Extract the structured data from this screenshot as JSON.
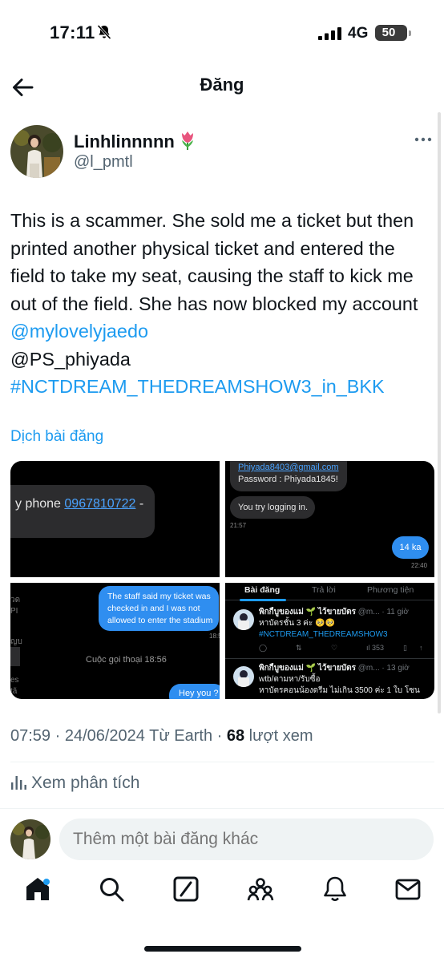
{
  "status_bar": {
    "time": "17:11",
    "network": "4G",
    "battery": "50"
  },
  "header": {
    "title": "Đăng"
  },
  "author": {
    "display_name": "Linhlinnnnn",
    "handle": "@l_pmtl"
  },
  "post": {
    "text": "This is a scammer. She sold me a ticket but then printed another physical ticket and entered the field to take my seat, causing the staff to kick me out of the field. She has now blocked my account ",
    "mention_1": "@mylovelyjaedo",
    "mention_2": "@PS_phiyada",
    "hashtag": "#NCTDREAM_THEDREAMSHOW3_in_BKK",
    "translate_label": "Dịch bài đăng"
  },
  "media": {
    "m1": {
      "prefix": "y phone ",
      "number": "0967810722",
      "suffix": " -"
    },
    "m2": {
      "email": "Phiyada8403@gmail.com",
      "password": "Password : Phiyada1845!",
      "msg": "You try logging in.",
      "time1": "21:57",
      "reply": "14 ka",
      "time2": "22:40"
    },
    "m3": {
      "side_1": "วด",
      "side_2": "PI",
      "side_3": "ญบ",
      "side_4": "es",
      "side_5": "tã",
      "blue_msg": "The staff said my ticket was checked in and I was not allowed to enter the stadium",
      "time": "18:5",
      "call": "Cuộc gọi thoại 18:56",
      "reply": "Hey you ?"
    },
    "m4": {
      "tab_1": "Bài đăng",
      "tab_2": "Trả lời",
      "tab_3": "Phương tiện",
      "p1_name": "พิกกี้บูของแม่ 🌱 ไว้ขายบัตร",
      "p1_meta": "@m... · 11 giờ",
      "p1_line": "หาบัตรชั้น 3 ค่ะ 🥺🥺",
      "p1_tag": "#NCTDREAM_THEDREAMSHOW3",
      "p1_views": "353",
      "p2_name": "พิกกี้บูของแม่ 🌱 ไว้ขายบัตร",
      "p2_meta": "@m... · 13 giờ",
      "p2_line1": "wtb/ตามหา/รับซื้อ",
      "p2_line2": "หาบัตรคอนน้องดรีม ไม่เกิน 3500 ค่ะ 1 ใบ โซน"
    }
  },
  "meta": {
    "time": "07:59 · 24/06/2024 Từ Earth · ",
    "views_count": "68",
    "views_label": " lượt xem"
  },
  "analytics": {
    "label": "Xem phân tích"
  },
  "reply": {
    "placeholder": "Thêm một bài đăng khác"
  },
  "colors": {
    "accent": "#1d9bf0",
    "text": "#0f1419",
    "muted": "#536471"
  }
}
